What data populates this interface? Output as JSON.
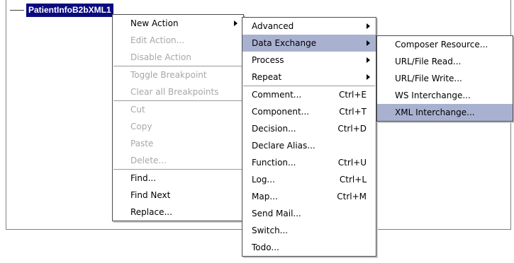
{
  "tree": {
    "root_label": "PatientInfoB2bXML1"
  },
  "context_menu": {
    "new_action": "New Action",
    "edit_action": "Edit Action...",
    "disable_action": "Disable Action",
    "toggle_breakpoint": "Toggle Breakpoint",
    "clear_all_breakpoints": "Clear all Breakpoints",
    "cut": "Cut",
    "copy": "Copy",
    "paste": "Paste",
    "delete": "Delete...",
    "find": "Find...",
    "find_next": "Find Next",
    "replace": "Replace..."
  },
  "new_action_menu": {
    "advanced": "Advanced",
    "data_exchange": "Data Exchange",
    "process": "Process",
    "repeat": "Repeat",
    "comment": "Comment...",
    "comment_shortcut": "Ctrl+E",
    "component": "Component...",
    "component_shortcut": "Ctrl+T",
    "decision": "Decision...",
    "decision_shortcut": "Ctrl+D",
    "declare_alias": "Declare Alias...",
    "function": "Function...",
    "function_shortcut": "Ctrl+U",
    "log": "Log...",
    "log_shortcut": "Ctrl+L",
    "map": "Map...",
    "map_shortcut": "Ctrl+M",
    "send_mail": "Send Mail...",
    "switch": "Switch...",
    "todo": "Todo..."
  },
  "data_exchange_menu": {
    "composer_resource": "Composer Resource...",
    "url_file_read": "URL/File Read...",
    "url_file_write": "URL/File Write...",
    "ws_interchange": "WS Interchange...",
    "xml_interchange": "XML Interchange..."
  },
  "colors": {
    "selection": "#a9b1d0",
    "tree_selected": "#0a0a80"
  }
}
